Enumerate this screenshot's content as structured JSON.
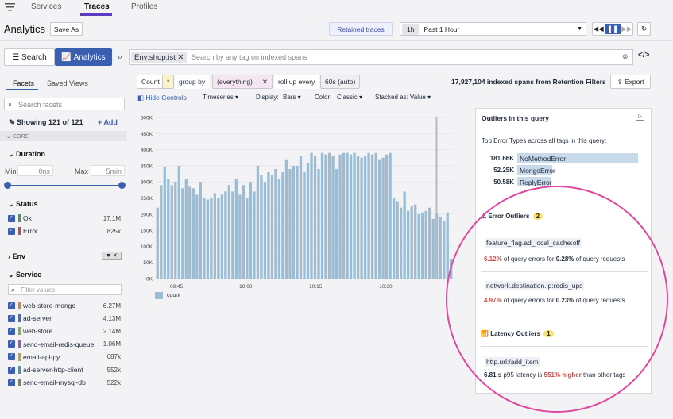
{
  "nav": {
    "tabs": [
      "Services",
      "Traces",
      "Profiles"
    ]
  },
  "header": {
    "title": "Analytics",
    "save_as": "Save As",
    "retained": "Retained traces",
    "range_short": "1h",
    "range": "Past 1 Hour"
  },
  "query": {
    "search": "Search",
    "analytics": "Analytics",
    "tag": "Env:shop.ist",
    "placeholder": "Search by any tag on indexed spans"
  },
  "builder": {
    "count": "Count",
    "star": "*",
    "group_by": "group by",
    "everything": "(everything)",
    "rollup": "roll up every",
    "rollup_val": "60s (auto)",
    "indexed": "17,927,104 indexed spans from Retention Filters",
    "export": "Export"
  },
  "controls": {
    "hide": "Hide Controls",
    "viz": "Timeseries",
    "display_l": "Display:",
    "display": "Bars",
    "color_l": "Color:",
    "color": "Classic",
    "stacked_l": "Stacked as:",
    "stacked": "Value"
  },
  "facets": {
    "tab1": "Facets",
    "tab2": "Saved Views",
    "search": "Search facets",
    "showing": "Showing 121 of 121",
    "add": "Add",
    "core": "CORE",
    "duration": "Duration",
    "min_l": "Min",
    "min": "0ns",
    "max_l": "Max",
    "max": "5min",
    "status": "Status",
    "status_items": [
      {
        "label": "Ok",
        "count": "17.1M",
        "color": "#3fa34d"
      },
      {
        "label": "Error",
        "count": "825k",
        "color": "#d64545"
      }
    ],
    "env": "Env",
    "service": "Service",
    "filter": "Filter values",
    "services": [
      {
        "label": "web-store-mongo",
        "count": "6.27M",
        "color": "#d9843b"
      },
      {
        "label": "ad-server",
        "count": "4.13M",
        "color": "#3a6fd8"
      },
      {
        "label": "web-store",
        "count": "2.14M",
        "color": "#7bb35a"
      },
      {
        "label": "send-email-redis-queue",
        "count": "1.06M",
        "color": "#9b59b6"
      },
      {
        "label": "email-api-py",
        "count": "687k",
        "color": "#c4a13a"
      },
      {
        "label": "ad-server-http-client",
        "count": "552k",
        "color": "#3aa0a8"
      },
      {
        "label": "send-email-mysql-db",
        "count": "522k",
        "color": "#7b8c3a"
      }
    ]
  },
  "chart_data": {
    "type": "bar",
    "x_ticks": [
      "09:45",
      "10:00",
      "10:15",
      "10:30"
    ],
    "y_ticks": [
      "0K",
      "50K",
      "100K",
      "150K",
      "200K",
      "250K",
      "300K",
      "350K",
      "400K",
      "450K",
      "500K"
    ],
    "ylim": [
      0,
      500000
    ],
    "legend": "count",
    "values": [
      220000,
      290000,
      345000,
      310000,
      290000,
      300000,
      350000,
      280000,
      310000,
      285000,
      280000,
      260000,
      300000,
      250000,
      245000,
      250000,
      265000,
      250000,
      260000,
      270000,
      290000,
      270000,
      310000,
      260000,
      290000,
      250000,
      300000,
      270000,
      350000,
      320000,
      300000,
      330000,
      320000,
      340000,
      310000,
      330000,
      370000,
      340000,
      350000,
      350000,
      380000,
      330000,
      360000,
      390000,
      380000,
      340000,
      390000,
      385000,
      390000,
      380000,
      340000,
      385000,
      390000,
      390000,
      385000,
      390000,
      380000,
      375000,
      380000,
      390000,
      385000,
      390000,
      370000,
      375000,
      385000,
      390000,
      250000,
      240000,
      220000,
      270000,
      210000,
      225000,
      230000,
      200000,
      205000,
      210000,
      220000,
      185000,
      200000,
      190000,
      180000,
      205000,
      60000
    ]
  },
  "outliers": {
    "title": "Outliers in this query",
    "top": "Top Error Types across all tags in this query:",
    "errors": [
      {
        "n": "181.66K",
        "name": "NoMethodError",
        "frac": 1.0
      },
      {
        "n": "52.25K",
        "name": "MongoError",
        "frac": 0.29
      },
      {
        "n": "50.58K",
        "name": "ReplyError",
        "frac": 0.28
      }
    ],
    "error_title": "Error Outliers",
    "error_count": "2",
    "e1_tag": "feature_flag.ad_local_cache:off",
    "e1_pct": "6.12%",
    "e1_mid": "of query errors for",
    "e1_pct2": "0.28%",
    "e1_end": "of query requests",
    "e2_tag": "network.destination.ip:redis_ups",
    "e2_pct": "4.97%",
    "e2_mid": "of query errors for",
    "e2_pct2": "0.23%",
    "e2_end": "of query requests",
    "lat_title": "Latency Outliers",
    "lat_count": "1",
    "l1_tag": "http.url:/add_item",
    "l1_val": "6.81 s",
    "l1_mid": "p95 latency is",
    "l1_hi": "551% higher",
    "l1_end": "than other tags"
  }
}
